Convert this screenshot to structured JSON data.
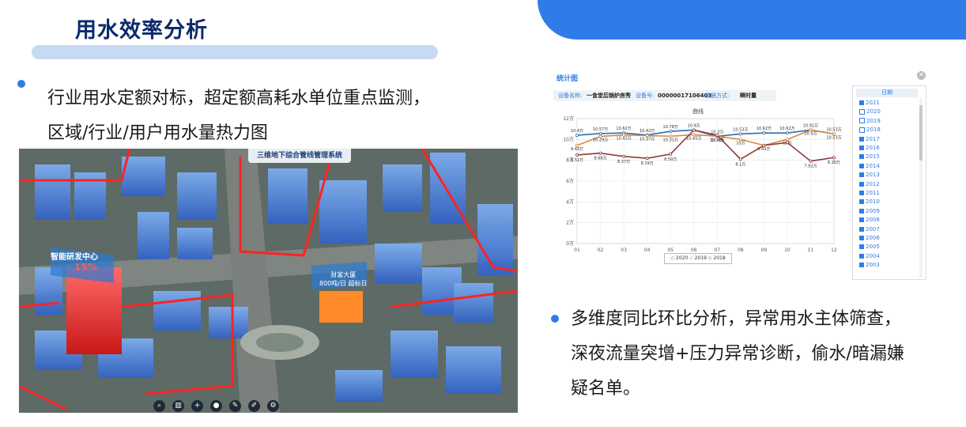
{
  "slide": {
    "title": "用水效率分析",
    "bullet1_line1": "行业用水定额对标，超定额高耗水单位重点监测，",
    "bullet1_line2": "区域/行业/用户用水量热力图",
    "bullet2_line1": "多维度同比环比分析，异常用水主体筛查，",
    "bullet2_line2": "深夜流量突增+压力异常诊断，偷水/暗漏嫌",
    "bullet2_line3": "疑名单。",
    "accent_color": "#2f7ce8"
  },
  "map": {
    "header": "三维地下综合管线管理系统",
    "label_center": "智能研发中心",
    "label_percent": "15%",
    "label_tower": "财富大厦",
    "label_tower_value": "800吨/日 超标日",
    "toolbar_icons": [
      "search-icon",
      "chart-icon",
      "plus-icon",
      "location-icon",
      "pen-icon",
      "draw-icon",
      "gear-icon"
    ]
  },
  "panel": {
    "title": "统计图",
    "close": "×",
    "device_name_label": "设备名称:",
    "device_name": "一食堂后锅炉房秀",
    "device_no_label": "设备号:",
    "device_no": "00000017106403",
    "mode_label": "数据方式:",
    "mode": "瞬时量",
    "chart_name": "曲线",
    "years_header": "日期",
    "years": [
      {
        "label": "2021",
        "checked": false
      },
      {
        "label": "2020",
        "checked": true
      },
      {
        "label": "2019",
        "checked": true
      },
      {
        "label": "2018",
        "checked": true
      },
      {
        "label": "2017",
        "checked": false
      },
      {
        "label": "2016",
        "checked": false
      },
      {
        "label": "2015",
        "checked": false
      },
      {
        "label": "2014",
        "checked": false
      },
      {
        "label": "2013",
        "checked": false
      },
      {
        "label": "2012",
        "checked": false
      },
      {
        "label": "2011",
        "checked": false
      },
      {
        "label": "2010",
        "checked": false
      },
      {
        "label": "2009",
        "checked": false
      },
      {
        "label": "2008",
        "checked": false
      },
      {
        "label": "2007",
        "checked": false
      },
      {
        "label": "2006",
        "checked": false
      },
      {
        "label": "2005",
        "checked": false
      },
      {
        "label": "2004",
        "checked": false
      },
      {
        "label": "2003",
        "checked": false
      }
    ]
  },
  "chart_data": {
    "type": "line",
    "x": [
      "01",
      "02",
      "03",
      "04",
      "05",
      "06",
      "07",
      "08",
      "09",
      "10",
      "11",
      "12"
    ],
    "yticks": [
      "0万",
      "2万",
      "4万",
      "6万",
      "8万",
      "10万",
      "12万"
    ],
    "ylim": [
      0,
      12
    ],
    "series": [
      {
        "name": "2020",
        "color": "#2e6db4",
        "values": [
          10.4,
          10.57,
          10.62,
          10.42,
          10.78,
          10.9,
          10.3,
          10.53,
          10.62,
          10.62,
          10.91,
          10.53
        ],
        "labels": [
          "10.4万",
          "10.57万",
          "10.62万",
          "10.42万",
          "10.78万",
          "10.9万",
          "10.3万",
          "10.53万",
          "10.62万",
          "10.62万",
          "10.91万",
          "10.53万"
        ]
      },
      {
        "name": "2019",
        "color": "#d88a3a",
        "values": [
          9.43,
          10.29,
          10.43,
          10.37,
          10.31,
          10.45,
          10.31,
          10.0,
          9.43,
          10.0,
          10.9,
          10.53
        ],
        "labels": [
          "9.43万",
          "10.29万",
          "10.43万",
          "10.37万",
          "10.31万",
          "10.45万",
          "10.31万",
          "10万",
          "9.43万",
          "10万",
          "10.9万",
          "10.53万"
        ]
      },
      {
        "name": "2018",
        "color": "#8b3a3a",
        "values": [
          8.51,
          8.68,
          8.37,
          8.19,
          8.59,
          10.9,
          10.4,
          8.1,
          9.43,
          9.7,
          7.92,
          8.26
        ],
        "labels": [
          "8.51万",
          "8.68万",
          "8.37万",
          "8.19万",
          "8.59万",
          "",
          "10.4万",
          "8.1万",
          "",
          "",
          "7.92万",
          "8.26万"
        ]
      }
    ],
    "legend": [
      "2020",
      "2019",
      "2018"
    ],
    "grid": true
  }
}
